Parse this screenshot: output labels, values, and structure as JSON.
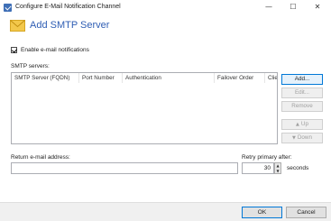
{
  "window": {
    "title": "Configure E-Mail Notification Channel",
    "minimize_glyph": "—",
    "maximize_glyph": "☐",
    "close_glyph": "✕",
    "app_icon": "check-app-icon"
  },
  "header": {
    "title": "Add SMTP Server",
    "icon": "envelope-icon",
    "accent_color": "#2f5eb4"
  },
  "enable_notifications": {
    "label": "Enable e-mail notifications",
    "checked": true
  },
  "smtp_servers": {
    "label": "SMTP servers:",
    "columns": [
      "SMTP Server (FQDN)",
      "Port Number",
      "Authentication",
      "Failover Order",
      "Clie"
    ],
    "rows": []
  },
  "side_buttons": {
    "add": "Add...",
    "edit": "Edit...",
    "remove": "Remove",
    "up": "Up",
    "down": "Down"
  },
  "return_email": {
    "label": "Return e-mail address:",
    "value": ""
  },
  "retry": {
    "label": "Retry primary after:",
    "value": "30",
    "unit": "seconds"
  },
  "footer": {
    "ok": "OK",
    "cancel": "Cancel"
  }
}
